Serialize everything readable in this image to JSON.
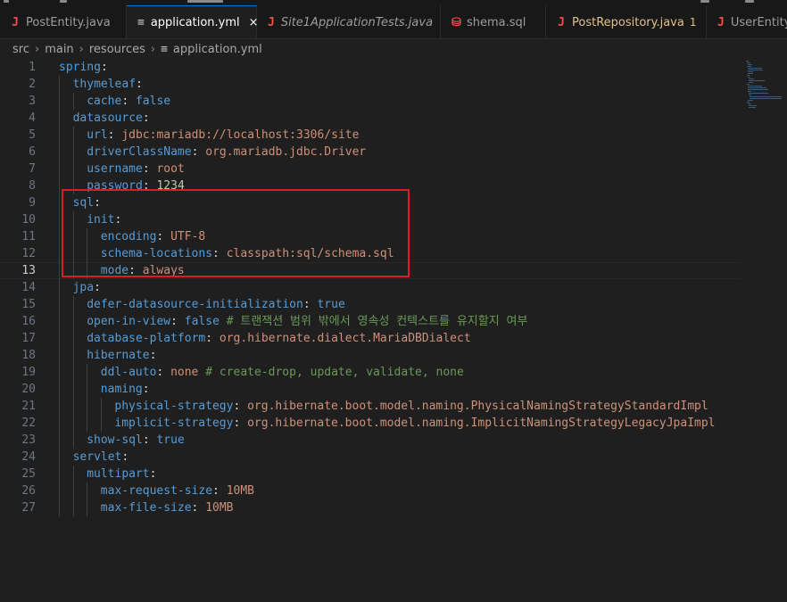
{
  "tabs": [
    {
      "icon": "J",
      "icon_type": "java",
      "label": "PostEntity.java",
      "italic": false,
      "active": false
    },
    {
      "icon": "≡",
      "icon_type": "yml",
      "label": "application.yml",
      "italic": false,
      "active": true,
      "close": "×"
    },
    {
      "icon": "J",
      "icon_type": "java",
      "label": "Site1ApplicationTests.java",
      "italic": true,
      "active": false
    },
    {
      "icon": "⛁",
      "icon_type": "db",
      "label": "shema.sql",
      "italic": false,
      "active": false
    },
    {
      "icon": "J",
      "icon_type": "java",
      "label": "PostRepository.java",
      "italic": false,
      "active": false,
      "modified": true,
      "badge": "1"
    },
    {
      "icon": "J",
      "icon_type": "java",
      "label": "UserEntity",
      "italic": false,
      "active": false
    }
  ],
  "breadcrumb": {
    "parts": [
      "src",
      "main",
      "resources"
    ],
    "file": "application.yml",
    "separator": "›"
  },
  "editor": {
    "current_line": 13,
    "lines": [
      {
        "n": "1",
        "indent": 0,
        "tokens": [
          [
            "k",
            "spring"
          ],
          [
            "p",
            ":"
          ]
        ]
      },
      {
        "n": "2",
        "indent": 1,
        "tokens": [
          [
            "k",
            "thymeleaf"
          ],
          [
            "p",
            ":"
          ]
        ]
      },
      {
        "n": "3",
        "indent": 2,
        "tokens": [
          [
            "k",
            "cache"
          ],
          [
            "p",
            ": "
          ],
          [
            "b",
            "false"
          ]
        ]
      },
      {
        "n": "4",
        "indent": 1,
        "tokens": [
          [
            "k",
            "datasource"
          ],
          [
            "p",
            ":"
          ]
        ]
      },
      {
        "n": "5",
        "indent": 2,
        "tokens": [
          [
            "k",
            "url"
          ],
          [
            "p",
            ": "
          ],
          [
            "s",
            "jdbc:mariadb://localhost:3306/site"
          ]
        ]
      },
      {
        "n": "6",
        "indent": 2,
        "tokens": [
          [
            "k",
            "driverClassName"
          ],
          [
            "p",
            ": "
          ],
          [
            "s",
            "org.mariadb.jdbc.Driver"
          ]
        ]
      },
      {
        "n": "7",
        "indent": 2,
        "tokens": [
          [
            "k",
            "username"
          ],
          [
            "p",
            ": "
          ],
          [
            "s",
            "root"
          ]
        ]
      },
      {
        "n": "8",
        "indent": 2,
        "tokens": [
          [
            "k",
            "password"
          ],
          [
            "p",
            ": "
          ],
          [
            "n",
            "1234"
          ]
        ]
      },
      {
        "n": "9",
        "indent": 1,
        "tokens": [
          [
            "k",
            "sql"
          ],
          [
            "p",
            ":"
          ]
        ]
      },
      {
        "n": "10",
        "indent": 2,
        "tokens": [
          [
            "k",
            "init"
          ],
          [
            "p",
            ":"
          ]
        ]
      },
      {
        "n": "11",
        "indent": 3,
        "tokens": [
          [
            "k",
            "encoding"
          ],
          [
            "p",
            ": "
          ],
          [
            "s",
            "UTF-8"
          ]
        ]
      },
      {
        "n": "12",
        "indent": 3,
        "tokens": [
          [
            "k",
            "schema-locations"
          ],
          [
            "p",
            ": "
          ],
          [
            "s",
            "classpath:sql/schema.sql"
          ]
        ]
      },
      {
        "n": "13",
        "indent": 3,
        "tokens": [
          [
            "k",
            "mode"
          ],
          [
            "p",
            ": "
          ],
          [
            "s",
            "always"
          ]
        ]
      },
      {
        "n": "14",
        "indent": 1,
        "tokens": [
          [
            "k",
            "jpa"
          ],
          [
            "p",
            ":"
          ]
        ]
      },
      {
        "n": "15",
        "indent": 2,
        "tokens": [
          [
            "k",
            "defer-datasource-initialization"
          ],
          [
            "p",
            ": "
          ],
          [
            "b",
            "true"
          ]
        ]
      },
      {
        "n": "16",
        "indent": 2,
        "tokens": [
          [
            "k",
            "open-in-view"
          ],
          [
            "p",
            ": "
          ],
          [
            "b",
            "false"
          ],
          [
            "p",
            " "
          ],
          [
            "c",
            "# 트랜잭션 범위 밖에서 영속성 컨텍스트를 유지할지 여부"
          ]
        ]
      },
      {
        "n": "17",
        "indent": 2,
        "tokens": [
          [
            "k",
            "database-platform"
          ],
          [
            "p",
            ": "
          ],
          [
            "s",
            "org.hibernate.dialect.MariaDBDialect"
          ]
        ]
      },
      {
        "n": "18",
        "indent": 2,
        "tokens": [
          [
            "k",
            "hibernate"
          ],
          [
            "p",
            ":"
          ]
        ]
      },
      {
        "n": "19",
        "indent": 3,
        "tokens": [
          [
            "k",
            "ddl-auto"
          ],
          [
            "p",
            ": "
          ],
          [
            "s",
            "none"
          ],
          [
            "p",
            " "
          ],
          [
            "c",
            "# create-drop, update, validate, none"
          ]
        ]
      },
      {
        "n": "20",
        "indent": 3,
        "tokens": [
          [
            "k",
            "naming"
          ],
          [
            "p",
            ":"
          ]
        ]
      },
      {
        "n": "21",
        "indent": 4,
        "tokens": [
          [
            "k",
            "physical-strategy"
          ],
          [
            "p",
            ": "
          ],
          [
            "s",
            "org.hibernate.boot.model.naming.PhysicalNamingStrategyStandardImpl"
          ]
        ]
      },
      {
        "n": "22",
        "indent": 4,
        "tokens": [
          [
            "k",
            "implicit-strategy"
          ],
          [
            "p",
            ": "
          ],
          [
            "s",
            "org.hibernate.boot.model.naming.ImplicitNamingStrategyLegacyJpaImpl"
          ]
        ]
      },
      {
        "n": "23",
        "indent": 2,
        "tokens": [
          [
            "k",
            "show-sql"
          ],
          [
            "p",
            ": "
          ],
          [
            "b",
            "true"
          ]
        ]
      },
      {
        "n": "24",
        "indent": 1,
        "tokens": [
          [
            "k",
            "servlet"
          ],
          [
            "p",
            ":"
          ]
        ]
      },
      {
        "n": "25",
        "indent": 2,
        "tokens": [
          [
            "k",
            "multipart"
          ],
          [
            "p",
            ":"
          ]
        ]
      },
      {
        "n": "26",
        "indent": 3,
        "tokens": [
          [
            "k",
            "max-request-size"
          ],
          [
            "p",
            ": "
          ],
          [
            "s",
            "10MB"
          ]
        ]
      },
      {
        "n": "27",
        "indent": 3,
        "tokens": [
          [
            "k",
            "max-file-size"
          ],
          [
            "p",
            ": "
          ],
          [
            "s",
            "10MB"
          ]
        ]
      }
    ]
  },
  "colors": {
    "key": "#569cd6",
    "string": "#ce9178",
    "number": "#b5cea8",
    "comment": "#6a9955",
    "highlight_box": "#e01b24",
    "active_tab_border": "#0078d4"
  }
}
